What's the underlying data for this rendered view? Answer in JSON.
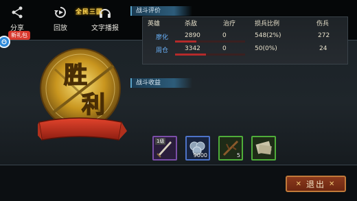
{
  "top_banner": "全民三国",
  "gift": {
    "label": "新礼包",
    "icon": "gift-icon"
  },
  "emblem": {
    "text_top": "胜",
    "text_bottom": "利"
  },
  "battle_section": {
    "title": "战斗评价",
    "headers": [
      "英雄",
      "杀敌",
      "治疗",
      "损兵比例",
      "伤兵"
    ],
    "rows": [
      {
        "name": "廖化",
        "kills": "2890",
        "heal": "0",
        "loss_ratio": "548(2%)",
        "wounded": "272",
        "bar_fill": 0.55
      },
      {
        "name": "周仓",
        "kills": "3342",
        "heal": "0",
        "loss_ratio": "50(0%)",
        "wounded": "24",
        "bar_fill": 0.8
      }
    ]
  },
  "loot_section": {
    "title": "战斗收益",
    "items": [
      {
        "name": "weapon-item",
        "badge": "1级",
        "count": "",
        "rarity": "purple"
      },
      {
        "name": "coins-item",
        "badge": "",
        "count": "9000",
        "rarity": "blue"
      },
      {
        "name": "wood-item",
        "badge": "",
        "count": "5",
        "rarity": "green"
      },
      {
        "name": "scroll-item",
        "badge": "",
        "count": "",
        "rarity": "green"
      }
    ]
  },
  "bottom": {
    "share": "分享",
    "replay": "回放",
    "broadcast": "文字播报",
    "exit": "退出"
  }
}
